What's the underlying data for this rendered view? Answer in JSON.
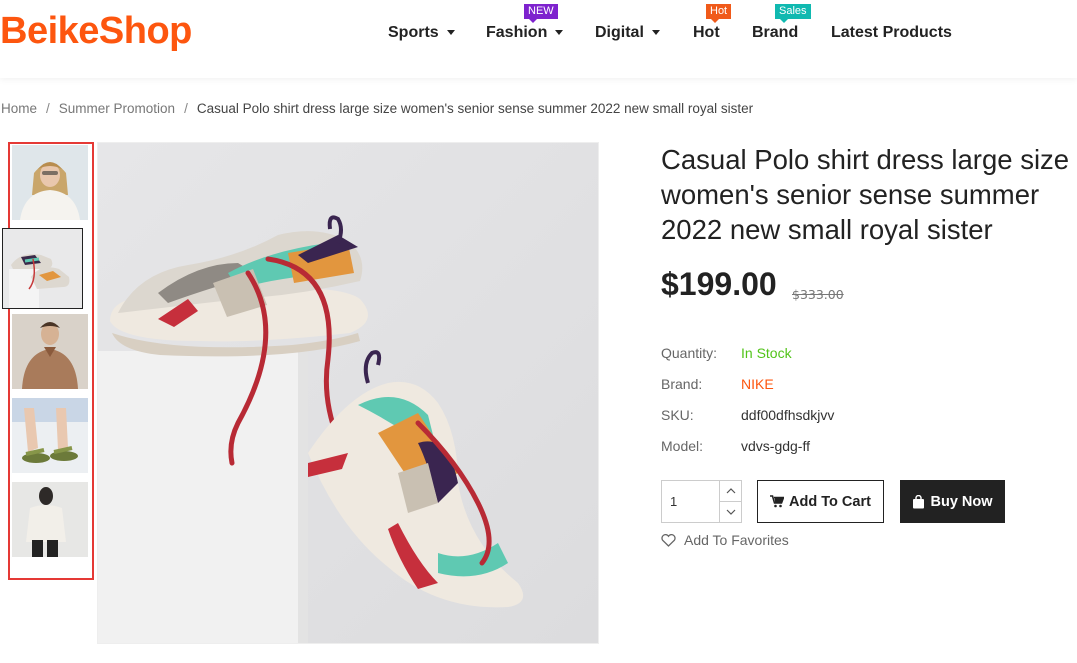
{
  "logo": {
    "text": "BeikeShop",
    "color": "#fd560f"
  },
  "nav": {
    "items": [
      {
        "label": "Sports",
        "dropdown": true
      },
      {
        "label": "Fashion",
        "dropdown": true,
        "badge": "NEW",
        "badge_color": "#7e22ce"
      },
      {
        "label": "Digital",
        "dropdown": true
      },
      {
        "label": "Hot",
        "dropdown": false,
        "badge": "Hot",
        "badge_color": "#f05a1a"
      },
      {
        "label": "Brand",
        "dropdown": false,
        "badge": "Sales",
        "badge_color": "#10b9b0"
      },
      {
        "label": "Latest Products",
        "dropdown": false
      }
    ]
  },
  "breadcrumb": {
    "home": "Home",
    "category": "Summer Promotion",
    "current": "Casual Polo shirt dress large size women's senior sense summer 2022 new small royal sister"
  },
  "thumbnails": [
    {
      "icon": "woman-white-sweater-photo"
    },
    {
      "icon": "sneakers-photo",
      "selected": true
    },
    {
      "icon": "man-brown-coat-photo"
    },
    {
      "icon": "sandals-photo"
    },
    {
      "icon": "man-white-tshirt-photo"
    }
  ],
  "product": {
    "title": "Casual Polo shirt dress large size women's senior sense summer 2022 new small royal sister",
    "price": "$199.00",
    "old_price": "$333.00",
    "attributes": {
      "quantity_label": "Quantity:",
      "quantity_value": "In Stock",
      "brand_label": "Brand:",
      "brand_value": "NIKE",
      "sku_label": "SKU:",
      "sku_value": "ddf00dfhsdkjvv",
      "model_label": "Model:",
      "model_value": "vdvs-gdg-ff"
    },
    "quantity": "1",
    "add_to_cart_label": "Add To Cart",
    "buy_now_label": "Buy Now",
    "favorites_label": "Add To Favorites"
  },
  "colors": {
    "in_stock": "#52c41a",
    "brand": "#fd560f",
    "thumb_highlight": "#e53935"
  }
}
